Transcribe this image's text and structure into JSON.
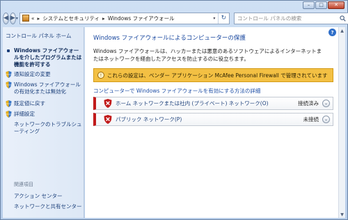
{
  "window": {
    "caption": {
      "minimize": "–",
      "maximize": "□",
      "close": "✕"
    }
  },
  "nav": {
    "back_glyph": "◀",
    "forward_glyph": "▶",
    "dropdown_glyph": "▾",
    "breadcrumb_prefix": "«",
    "breadcrumb": [
      "システムとセキュリティ",
      "Windows ファイアウォール"
    ],
    "breadcrumb_sep": "▸",
    "refresh_glyph": "↻",
    "search_placeholder": "コントロール パネルの検索"
  },
  "sidebar": {
    "home": "コントロール パネル ホーム",
    "items": [
      {
        "label": "Windows ファイアウォールを介したプログラムまたは機能を許可する",
        "icon": "bullet",
        "bold": true
      },
      {
        "label": "通知設定の変更",
        "icon": "shield-icon",
        "bold": false
      },
      {
        "label": "Windows ファイアウォールの有効化または無効化",
        "icon": "shield-icon",
        "bold": false
      },
      {
        "label": "既定値に戻す",
        "icon": "shield-icon",
        "bold": false
      },
      {
        "label": "詳細設定",
        "icon": "shield-icon",
        "bold": false
      },
      {
        "label": "ネットワークのトラブルシューティング",
        "icon": "none",
        "bold": false
      }
    ],
    "related_heading": "関連項目",
    "related_links": [
      "アクション センター",
      "ネットワークと共有センター"
    ]
  },
  "main": {
    "help_glyph": "?",
    "title": "Windows ファイアウォールによるコンピューターの保護",
    "description": "Windows ファイアウォールは、ハッカーまたは悪意のあるソフトウェアによるインターネットまたはネットワークを経由したアクセスを防止するのに役立ちます。",
    "banner": {
      "text": "これらの設定は、ベンダー アプリケーション McAfee Personal Firewall で管理されています",
      "color": "#f3c043"
    },
    "help_link": "コンピューターで Windows ファイアウォールを有効にする方法の詳細",
    "networks": [
      {
        "label": "ホーム ネットワークまたは社内 (プライベート) ネットワーク(O)",
        "status": "接続済み",
        "chevron": "⌄"
      },
      {
        "label": "パブリック ネットワーク(P)",
        "status": "未接続",
        "chevron": "⌄"
      }
    ],
    "status_color": "#c11b1b"
  }
}
